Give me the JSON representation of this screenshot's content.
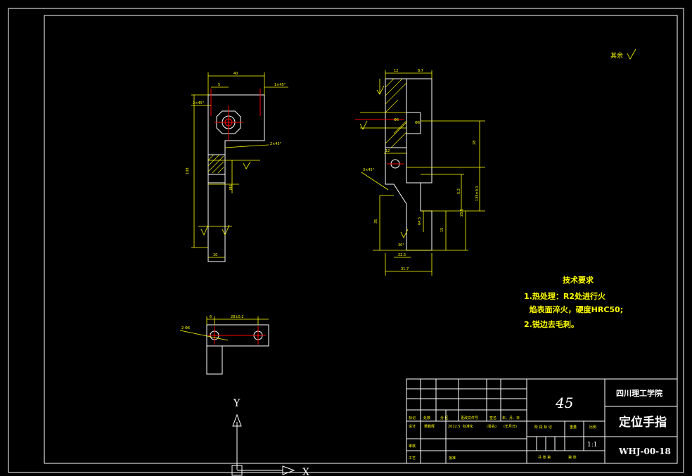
{
  "roughness": {
    "label": "其余",
    "symbol": "∇"
  },
  "tech_requirements": {
    "title": "技术要求",
    "items": [
      "1.热处理：R2处进行火",
      "  焰表面淬火，硬度HRC50;",
      "2.锐边去毛刺。"
    ]
  },
  "title_block": {
    "material": "45",
    "school": "四川理工学院",
    "part_name": "定位手指",
    "drawing_no": "WHJ-00-18",
    "scale": "1:1",
    "labels": {
      "mark": "标记",
      "count": "处数",
      "zone": "分 区",
      "change_doc": "更改文件号",
      "sign": "签名",
      "date": "年、月、日",
      "design": "设计",
      "designer": "吴鹏辉",
      "design_date": "2012.5",
      "standardize": "标准化",
      "sign2": "(签名)",
      "date2": "(年月日)",
      "stage_mark": "阶 段 标 记",
      "weight": "重量",
      "scale_label": "比例",
      "review": "审核",
      "process": "工艺",
      "approve": "批准",
      "sheets_total": "共 张 第",
      "sheet_no": "第 张"
    }
  },
  "axis": {
    "y": "Y",
    "x": "X"
  },
  "dims": {
    "front": [
      "40",
      "5",
      "1×45°",
      "2×45°",
      "R2",
      "108",
      "10",
      "2×45°",
      "Φ6",
      "12",
      "M6"
    ],
    "side": [
      "12",
      "8.7",
      "28",
      "Φ6",
      "3×45°",
      "15",
      "35",
      "5.2",
      "64.5",
      "31.7",
      "22.5",
      "30°",
      "135±0.1",
      "28.5"
    ],
    "top": [
      "6",
      "28±0.2",
      "2-Φ6"
    ]
  }
}
